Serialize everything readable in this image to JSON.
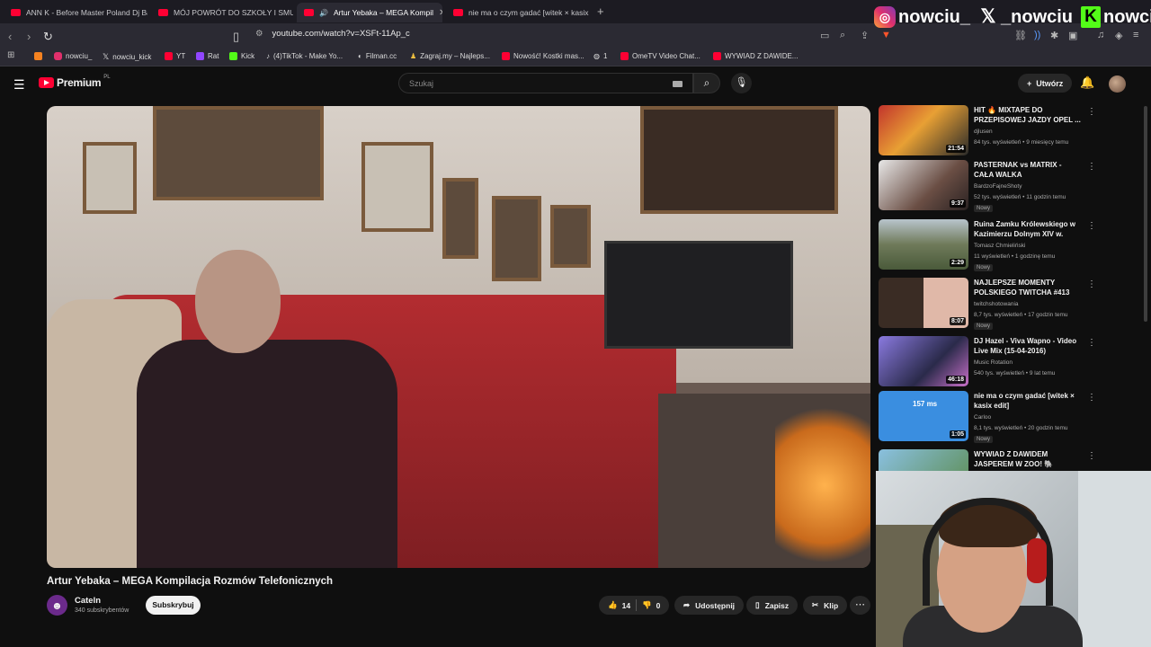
{
  "tabs": [
    {
      "label": "ANN K - Before Master Poland Dj Ba"
    },
    {
      "label": "MÓJ POWRÓT DO SZKOŁY I SMUTN"
    },
    {
      "label": "Artur Yebaka – MEGA Kompil"
    },
    {
      "label": "nie ma o czym gadać [witek × kasix e"
    }
  ],
  "overlay": {
    "instagram": "nowciu_",
    "x": "_nowciu",
    "kick": "nowciu"
  },
  "address": {
    "url": "youtube.com/watch?v=XSFt-11Ap_c"
  },
  "bookmarks": [
    {
      "label": "",
      "color": "#f58220"
    },
    {
      "label": "nowciu_",
      "color": "#e1306c"
    },
    {
      "label": "nowciu_kick",
      "color": "#ffffff"
    },
    {
      "label": "YT",
      "color": "#ff0033"
    },
    {
      "label": "Rat",
      "color": "#9146ff"
    },
    {
      "label": "Kick",
      "color": "#53fc18"
    },
    {
      "label": "(4)TikTok - Make Yo...",
      "color": "#ffffff"
    },
    {
      "label": "Filman.cc",
      "color": "#cccccc"
    },
    {
      "label": "Zagraj.my – Najleps...",
      "color": "#f0c040"
    },
    {
      "label": "Nowość! Kostki mas...",
      "color": "#ff0033"
    },
    {
      "label": "1",
      "color": "#888888"
    },
    {
      "label": "OmeTV Video Chat...",
      "color": "#ff0033"
    },
    {
      "label": "WYWIAD Z DAWIDE...",
      "color": "#ff0033"
    }
  ],
  "youtube": {
    "logo": "Premium",
    "logo_region": "PL",
    "search_placeholder": "Szukaj",
    "create_label": "Utwórz"
  },
  "video": {
    "title": "Artur Yebaka – MEGA Kompilacja Rozmów Telefonicznych",
    "channel": "Cateln",
    "subscribers": "340 subskrybentów",
    "subscribe_label": "Subskrybuj",
    "likes": "14",
    "dislikes": "0",
    "share_label": "Udostępnij",
    "save_label": "Zapisz",
    "clip_label": "Klip"
  },
  "recommendations": [
    {
      "title": "HIT 🔥 MIXTAPE DO PRZEPISOWEJ JAZDY OPEL ...",
      "channel": "djlusen",
      "meta": "84 tys. wyświetleń • 9 miesięcy temu",
      "duration": "21:54",
      "new": "",
      "thumb": "#b8322a"
    },
    {
      "title": "PASTERNAK vs MATRIX - CAŁA WALKA",
      "channel": "BardzoFajneShoty",
      "meta": "52 tys. wyświetleń • 11 godzin temu",
      "duration": "9:37",
      "new": "Nowy",
      "thumb": "#5a4a44"
    },
    {
      "title": "Ruina Zamku Królewskiego w Kazimierzu Dolnym XIV w.",
      "channel": "Tomasz Chmieliński",
      "meta": "11 wyświetleń • 1 godzinę temu",
      "duration": "2:29",
      "new": "Nowy",
      "thumb": "#6f7a5a"
    },
    {
      "title": "NAJLEPSZE MOMENTY POLSKIEGO TWITCHA #413",
      "channel": "twitchshotowania",
      "meta": "8,7 tys. wyświetleń • 17 godzin temu",
      "duration": "8:07",
      "new": "Nowy",
      "thumb": "#8a6a8a"
    },
    {
      "title": "DJ Hazel - Viva Wapno - Video Live Mix (15-04-2016)",
      "channel": "Music Rotation",
      "meta": "540 tys. wyświetleń • 9 lat temu",
      "duration": "46:18",
      "new": "",
      "thumb": "#6a5ac8"
    },
    {
      "title": "nie ma o czym gadać [witek × kasix edit]",
      "channel": "Carloo",
      "meta": "8,1 tys. wyświetleń • 20 godzin temu",
      "duration": "1:05",
      "new": "Nowy",
      "thumb": "#3a8ee0"
    },
    {
      "title": "WYWIAD Z DAWIDEM JASPEREM W ZOO! 🐘",
      "channel": "",
      "meta": "",
      "duration": "",
      "new": "",
      "thumb": "#5a8a4a"
    }
  ],
  "rec6_overlay": "157 ms"
}
